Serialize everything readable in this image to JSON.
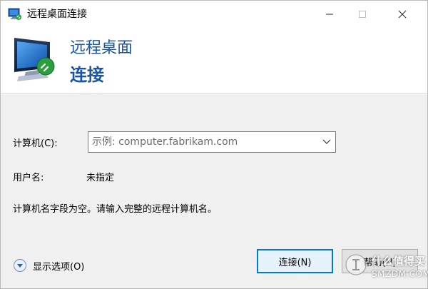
{
  "window": {
    "title": "远程桌面连接",
    "controls": {
      "minimize": "minimize-icon",
      "maximize": "maximize-icon",
      "close": "close-icon"
    }
  },
  "banner": {
    "line1": "远程桌面",
    "line2": "连接",
    "icon": "remote-desktop-monitor-icon"
  },
  "form": {
    "computer_label": "计算机(C):",
    "computer_placeholder": "示例: computer.fabrikam.com",
    "computer_value": "",
    "username_label": "用户名:",
    "username_value": "未指定",
    "message": "计算机名字段为空。请输入完整的远程计算机名。"
  },
  "footer": {
    "show_options_label": "显示选项(O)",
    "connect_label": "连接(N)",
    "help_label": "帮助(H)"
  },
  "watermark": {
    "line1": "什么值得买",
    "line2": "SMZDM.COM"
  },
  "colors": {
    "accent_blue": "#1a56a8",
    "button_focus_border": "#0078d7",
    "window_bg": "#f0f0f0"
  }
}
